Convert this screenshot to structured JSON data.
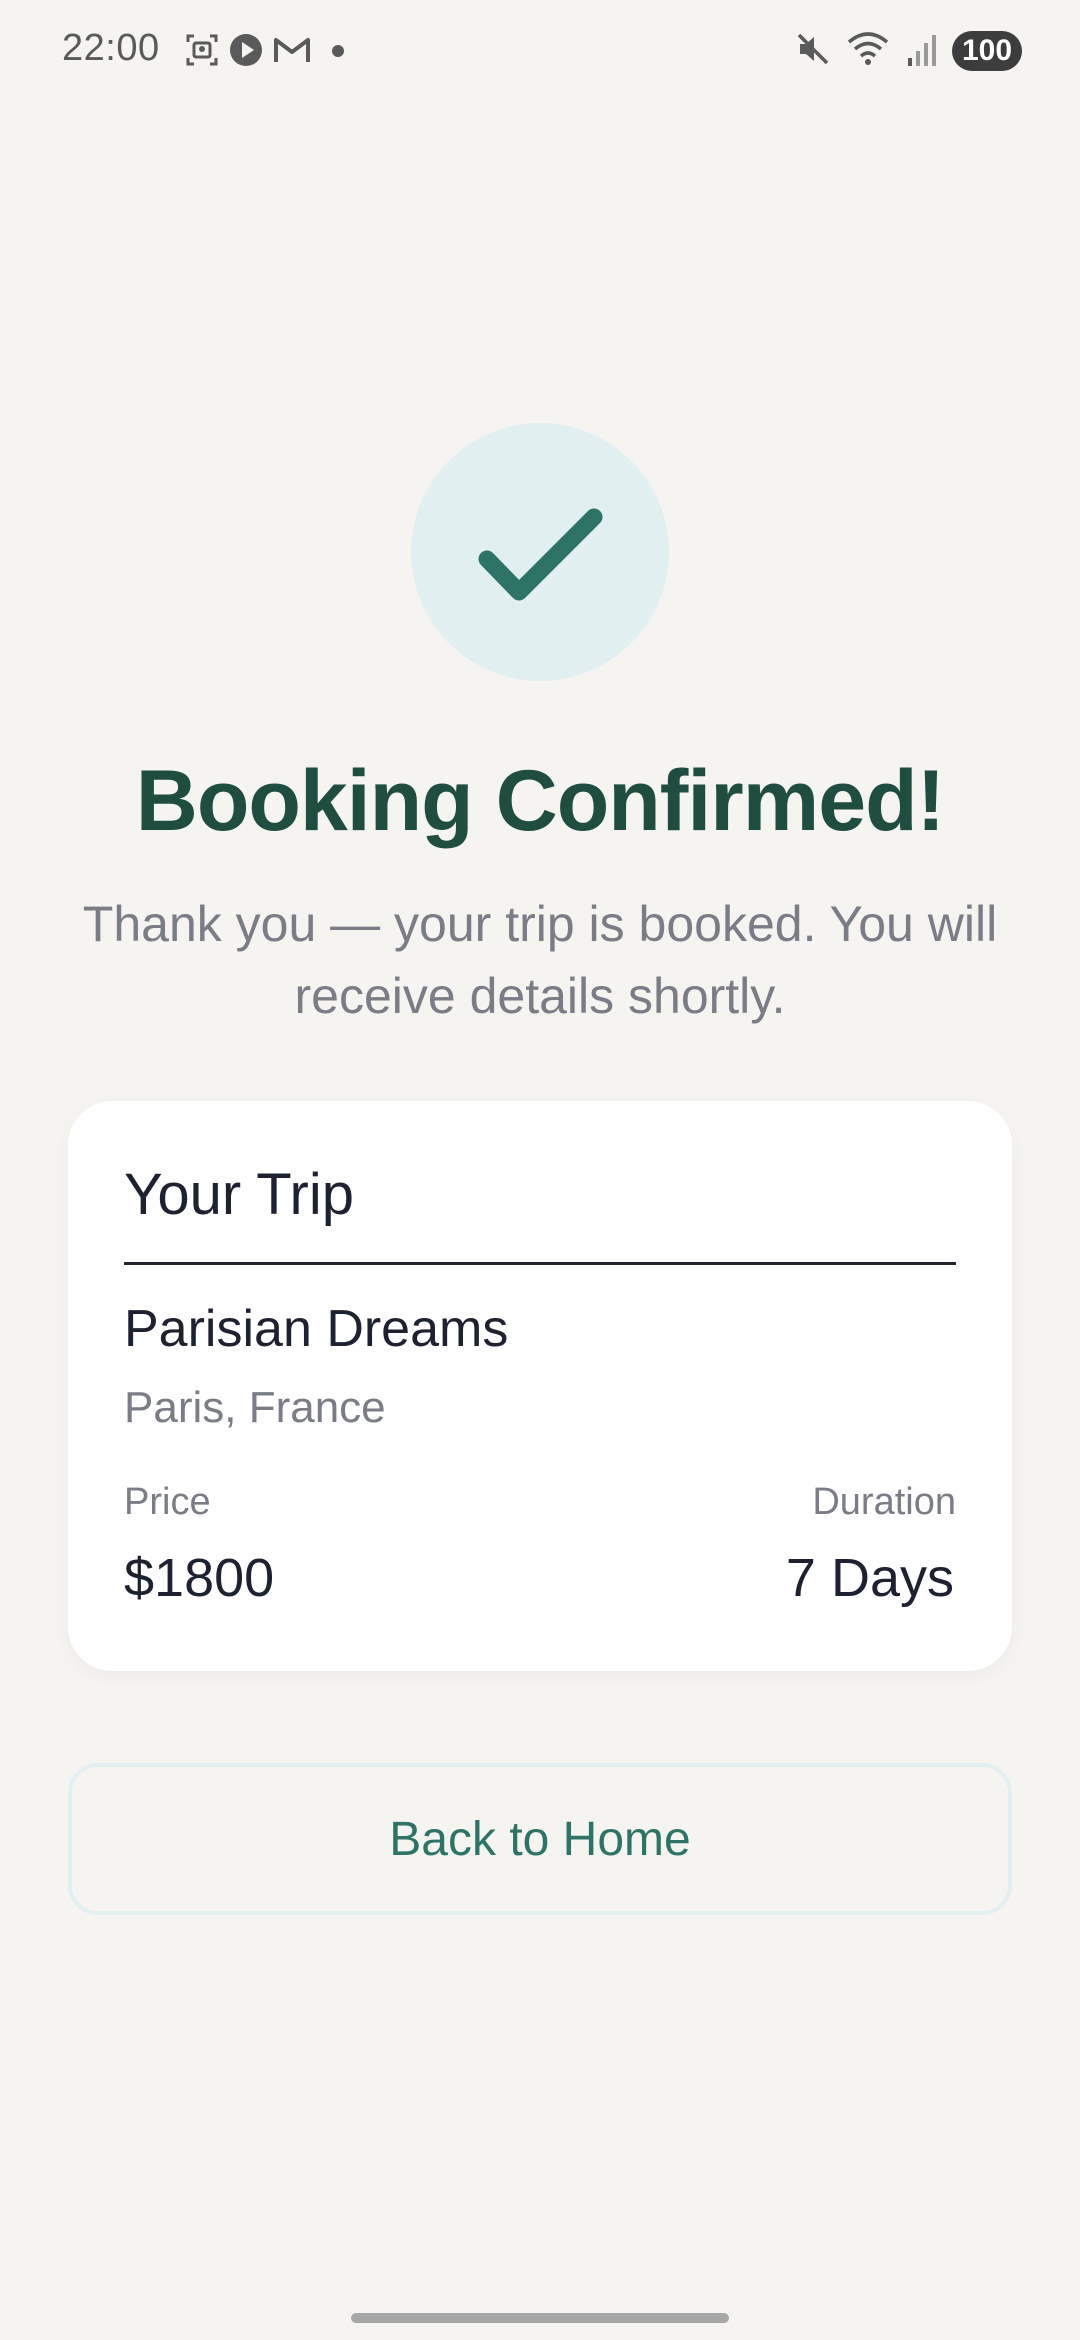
{
  "status_bar": {
    "time": "22:00",
    "battery": "100",
    "left_icons": [
      "screenshot-icon",
      "media-play-icon",
      "gmail-icon",
      "dot-icon"
    ],
    "right_icons": [
      "mute-icon",
      "wifi-icon",
      "signal-icon"
    ]
  },
  "confirmation": {
    "title": "Booking Confirmed!",
    "message": "Thank you — your trip is booked. You will receive details shortly.",
    "icon": "checkmark-icon",
    "accent_color": "#1f4d40",
    "badge_color": "#e1eff0"
  },
  "trip_card": {
    "header": "Your Trip",
    "name": "Parisian Dreams",
    "location": "Paris, France",
    "price_label": "Price",
    "price": "$1800",
    "duration_label": "Duration",
    "duration": "7 Days"
  },
  "actions": {
    "back_home_label": "Back to Home",
    "button_text_color": "#2e7466"
  }
}
